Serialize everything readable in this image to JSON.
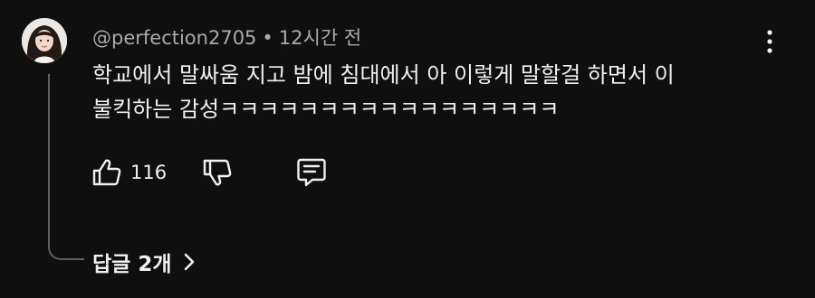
{
  "comment": {
    "author_handle": "@perfection2705",
    "separator": "•",
    "timestamp": "12시간 전",
    "text_line_1": "학교에서 말싸움 지고 밤에 침대에서 아 이렇게 말할걸 하면서 이",
    "text_line_2": "불킥하는 감성ㅋㅋㅋㅋㅋㅋㅋㅋㅋㅋㅋㅋㅋㅋㅋㅋㅋ",
    "like_count": "116",
    "replies_label": "답글 2개"
  },
  "icons": {
    "more": "more-vert-icon",
    "like": "thumbs-up-icon",
    "dislike": "thumbs-down-icon",
    "reply": "comment-reply-icon",
    "expand": "chevron-right-icon"
  },
  "colors": {
    "background": "#0f0f0f",
    "text_primary": "#f1f1f1",
    "text_secondary": "#aaaaaa",
    "thread_line": "#5f5f5f"
  }
}
